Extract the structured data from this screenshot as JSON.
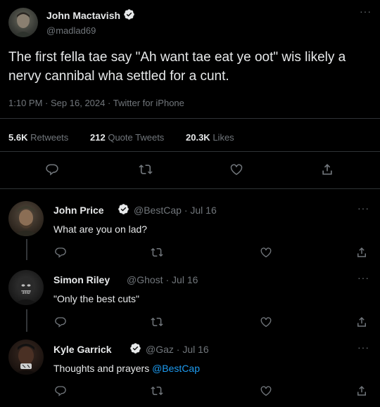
{
  "main_tweet": {
    "author_name": "John Mactavish",
    "handle": "@madlad69",
    "text": "The first fella tae say \"Ah want tae eat ye oot\" wis likely a nervy cannibal wha settled for a cunt.",
    "time": "1:10 PM",
    "date": "Sep 16, 2024",
    "source": "Twitter for iPhone",
    "retweets_count": "5.6K",
    "retweets_label": "Retweets",
    "quotes_count": "212",
    "quotes_label": "Quote Tweets",
    "likes_count": "20.3K",
    "likes_label": "Likes"
  },
  "replies": [
    {
      "author_name": "John Price",
      "handle": "@BestCap",
      "date": "Jul 16",
      "text": "What are you on lad?",
      "verified": true
    },
    {
      "author_name": "Simon Riley",
      "handle": "@Ghost",
      "date": "Jul 16",
      "text": "\"Only the best cuts\"",
      "verified": false
    },
    {
      "author_name": "Kyle Garrick",
      "handle": "@Gaz",
      "date": "Jul 16",
      "text": "Thoughts and prayers ",
      "mention": "@BestCap",
      "verified": true
    }
  ],
  "ui": {
    "separator": "·",
    "more": "···",
    "accent_color": "#1d9bf0",
    "icons": [
      "reply-icon",
      "retweet-icon",
      "like-icon",
      "share-icon",
      "verified-icon",
      "more-icon"
    ]
  }
}
